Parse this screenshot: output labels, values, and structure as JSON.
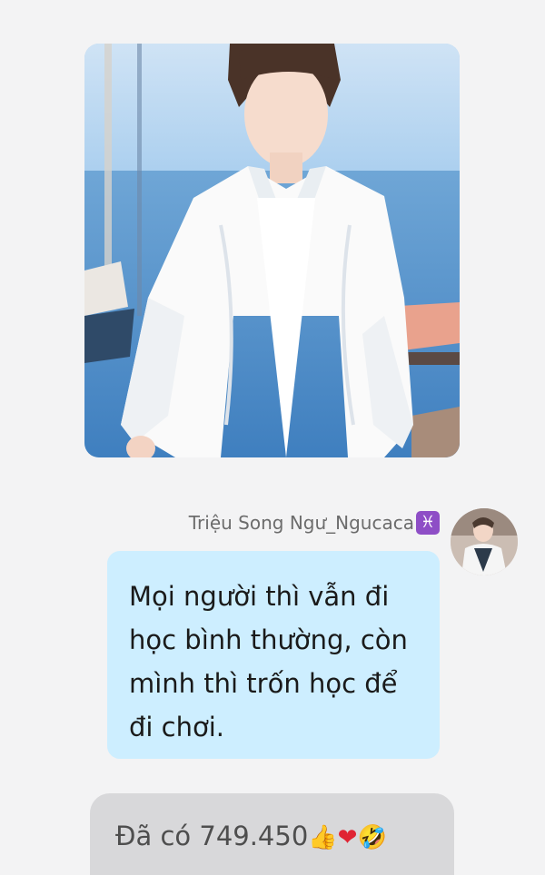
{
  "message": {
    "sender_name": "Triệu Song Ngư_Ngucaca",
    "zodiac_symbol": "♓",
    "text": "Mọi người thì vẫn đi học bình thường, còn mình thì trốn học để đi chơi."
  },
  "reactions": {
    "prefix": "Đã có 749.450",
    "icons": [
      "thumbs-up-icon",
      "heart-icon",
      "laughing-emoji-icon"
    ]
  },
  "colors": {
    "page_background": "#f3f3f4",
    "bubble_background": "#cdeeff",
    "reaction_bar": "#d8d8da",
    "zodiac_badge": "#8e4ec6"
  }
}
